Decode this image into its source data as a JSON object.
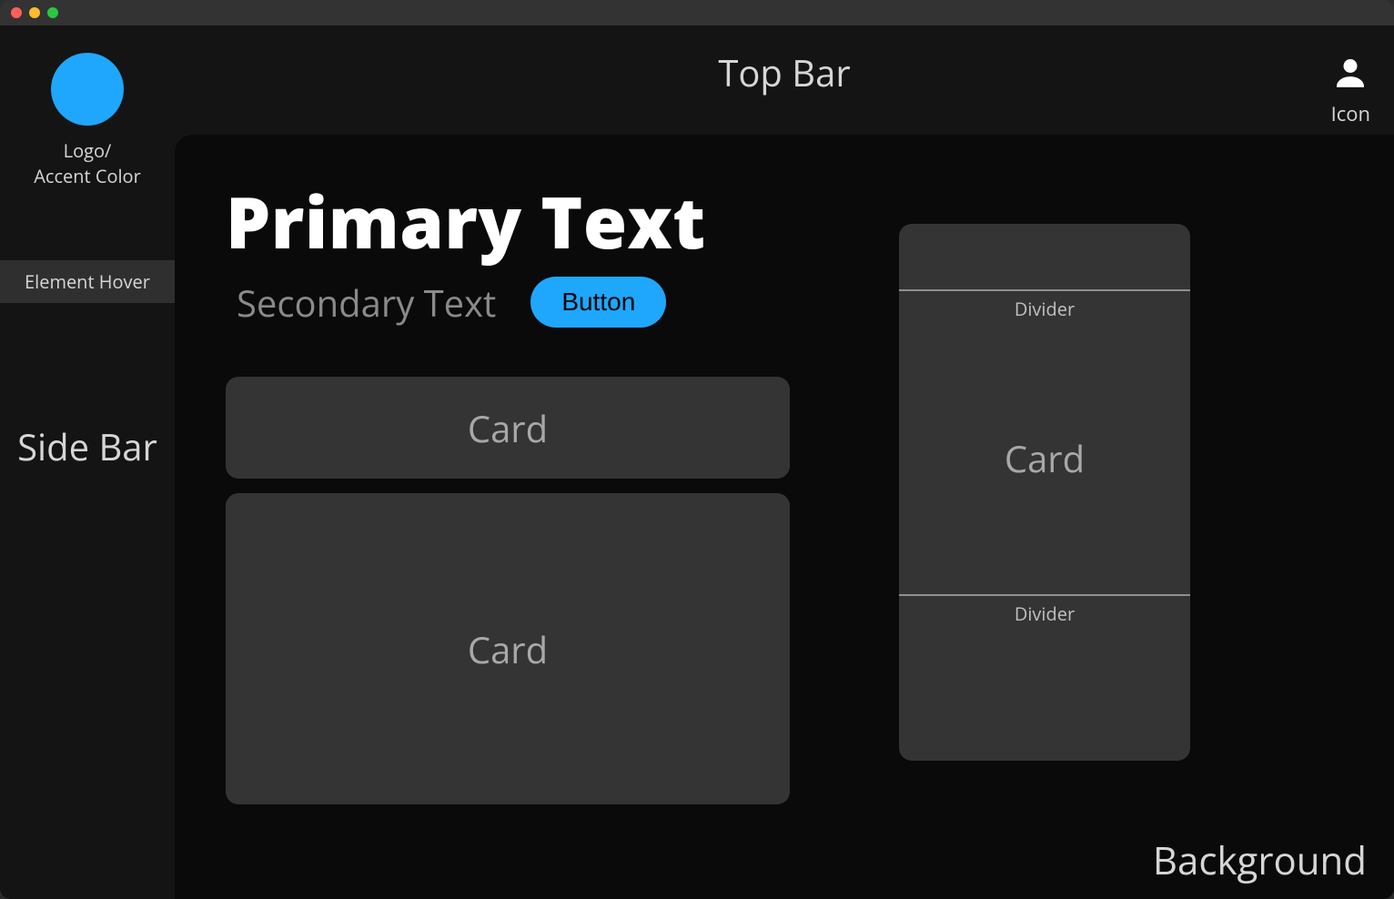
{
  "topbar": {
    "title": "Top Bar",
    "icon_label": "Icon"
  },
  "sidebar": {
    "logo_label_line1": "Logo/",
    "logo_label_line2": "Accent Color",
    "hover_label": "Element Hover",
    "title": "Side Bar"
  },
  "main": {
    "primary_text": "Primary Text",
    "secondary_text": "Secondary Text",
    "button_label": "Button",
    "card_small_label": "Card",
    "card_large_label": "Card",
    "right_card_label": "Card",
    "divider_label_top": "Divider",
    "divider_label_bottom": "Divider",
    "background_label": "Background"
  },
  "colors": {
    "accent": "#1ea7fd",
    "bg_dark": "#0a0a0a",
    "bg_panel": "#141414",
    "card": "#343434"
  }
}
